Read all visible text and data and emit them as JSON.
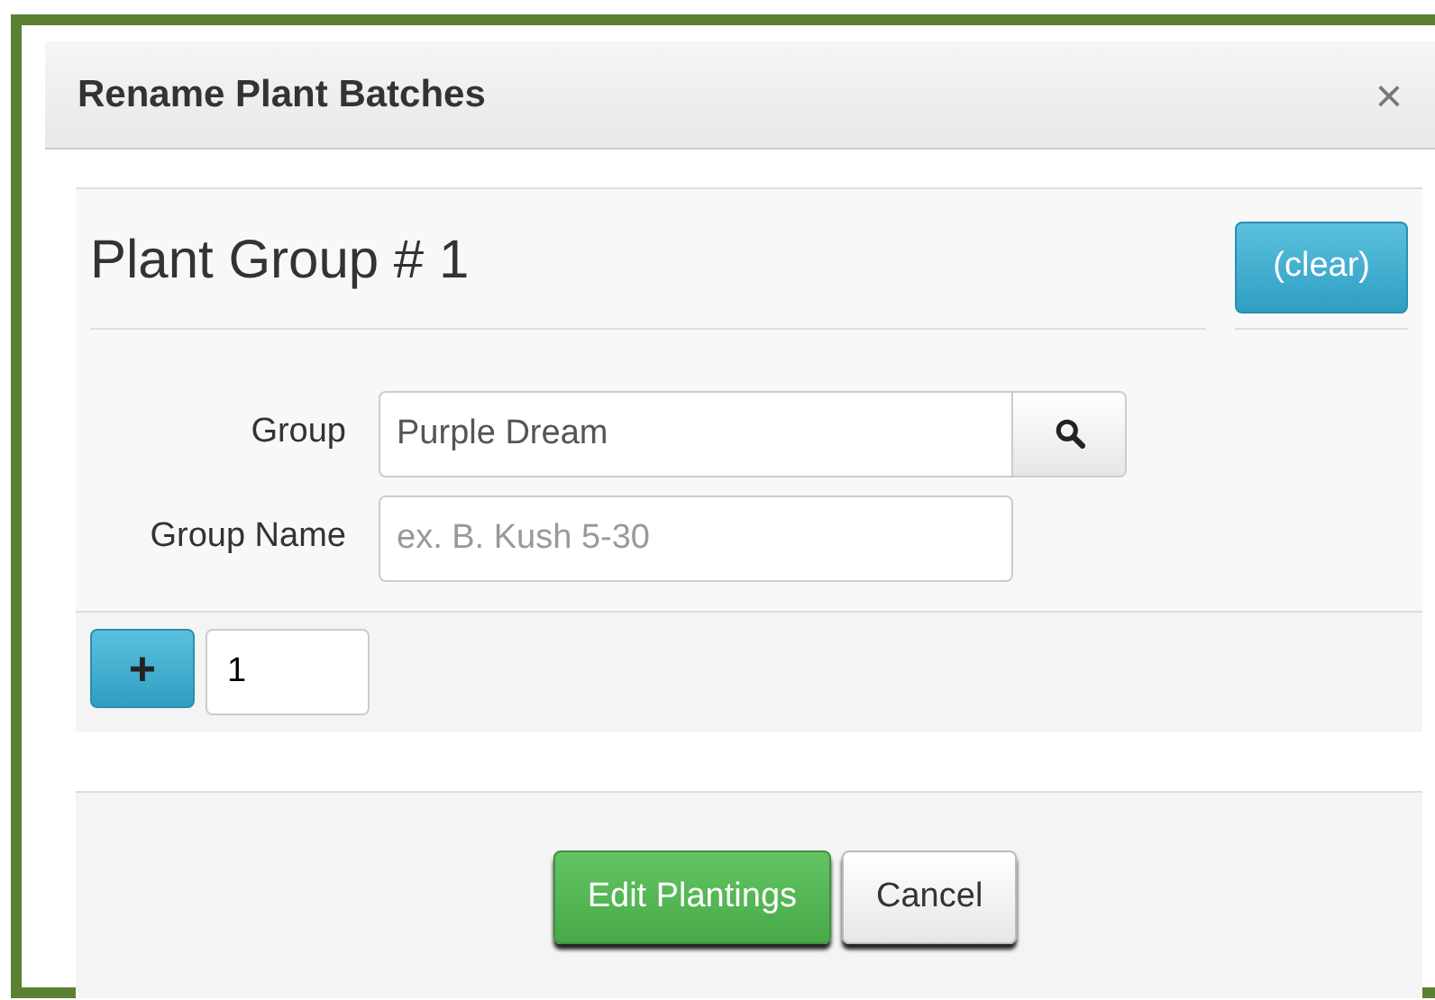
{
  "dialog": {
    "title": "Rename Plant Batches",
    "close": "×"
  },
  "group": {
    "title": "Plant Group # 1",
    "clear_button": "(clear)",
    "fields": [
      {
        "label": "Group",
        "value": "Purple Dream",
        "kind": "search"
      },
      {
        "label": "Group Name",
        "placeholder": "ex. B. Kush 5-30",
        "kind": "text"
      }
    ],
    "add_button": "+",
    "count": "1"
  },
  "buttons": [
    {
      "label": "Edit Plantings",
      "kind": "primary"
    },
    {
      "label": "Cancel",
      "kind": "default"
    }
  ]
}
